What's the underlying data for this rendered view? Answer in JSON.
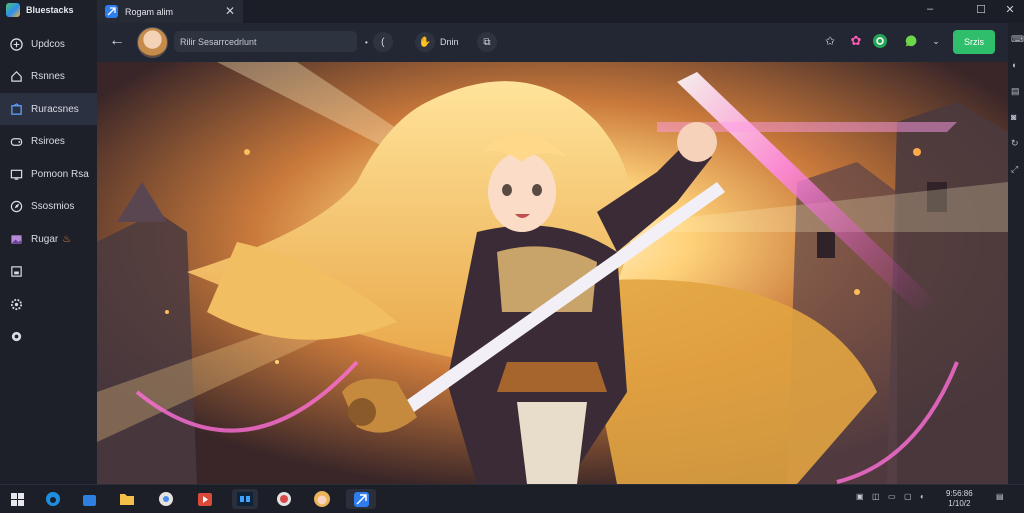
{
  "app": {
    "title": "Bluestacks",
    "tab_title": "Rogam alim",
    "tab_close": "✕"
  },
  "window_controls": [
    "‒",
    "☐",
    "✕"
  ],
  "sidebar": {
    "items": [
      {
        "label": "Updcos",
        "icon": "globe-icon"
      },
      {
        "label": "Rsnnes",
        "icon": "home-icon"
      },
      {
        "label": "Ruracsnes",
        "icon": "library-icon"
      },
      {
        "label": "Rsiroes",
        "icon": "gamepad-icon"
      },
      {
        "label": "Pomoon Rsa",
        "icon": "screen-icon"
      },
      {
        "label": "Ssosmios",
        "icon": "compass-icon"
      },
      {
        "label": "Rugar",
        "icon": "image-icon"
      },
      {
        "label": "",
        "icon": "save-icon"
      },
      {
        "label": "",
        "icon": "gear-icon"
      },
      {
        "label": "",
        "icon": "circle-icon"
      }
    ]
  },
  "toolbar": {
    "back": "←",
    "search_text": "Rilir Sesarrcedrlunt",
    "btn_a": "(",
    "btn_b_label": "Dnin",
    "action_label": "Srzis"
  },
  "colors": {
    "accent": "#2fbe6b",
    "active": "#2b3140",
    "tab_icon": "#2f7ef0"
  },
  "taskbar": {
    "apps": [
      "start-icon",
      "edge-icon",
      "store-icon",
      "folder-icon",
      "chrome-icon",
      "media-icon",
      "terminal-icon",
      "photos-icon",
      "game-icon",
      "bluestacks-icon"
    ],
    "clock_time": "9:56:86",
    "clock_date": "1/10/2"
  }
}
